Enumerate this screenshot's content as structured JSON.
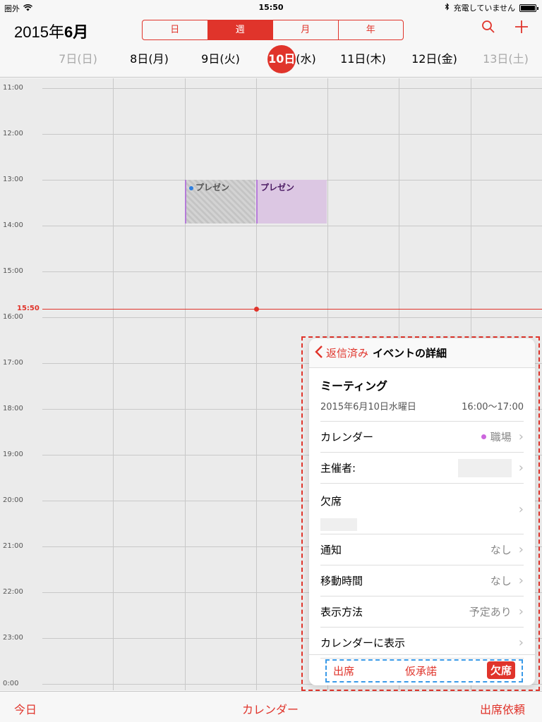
{
  "status": {
    "carrier": "圏外",
    "time": "15:50",
    "charge": "充電していません"
  },
  "header": {
    "year": "2015年",
    "month": "6月",
    "segments": [
      "日",
      "週",
      "月",
      "年"
    ],
    "active_segment": "週",
    "days": [
      "7日(日)",
      "8日(月)",
      "9日(火)",
      "10日",
      "11日(木)",
      "12日(金)",
      "13日(土)"
    ],
    "today_suffix": "(水)"
  },
  "grid": {
    "hours": [
      "11:00",
      "12:00",
      "13:00",
      "14:00",
      "15:00",
      "16:00",
      "17:00",
      "18:00",
      "19:00",
      "20:00",
      "21:00",
      "22:00",
      "23:00",
      "0:00"
    ],
    "now": "15:50",
    "events": [
      {
        "title": "プレゼン",
        "day": "9日(火)"
      },
      {
        "title": "プレゼン",
        "day": "10日"
      }
    ]
  },
  "popover": {
    "back": "返信済み",
    "title": "イベントの詳細",
    "event_title": "ミーティング",
    "date": "2015年6月10日水曜日",
    "time": "16:00〜17:00",
    "rows": {
      "calendar_label": "カレンダー",
      "calendar_value": "職場",
      "organizer_label": "主催者:",
      "declined_label": "欠席",
      "alert_label": "通知",
      "alert_value": "なし",
      "travel_label": "移動時間",
      "travel_value": "なし",
      "show_as_label": "表示方法",
      "show_as_value": "予定あり",
      "show_in_cal_label": "カレンダーに表示"
    },
    "responses": {
      "accept": "出席",
      "maybe": "仮承諾",
      "decline": "欠席"
    }
  },
  "toolbar": {
    "today": "今日",
    "calendars": "カレンダー",
    "invitations": "出席依頼"
  },
  "colors": {
    "accent": "#e0342b",
    "event": "#dcc7e3",
    "highlight_blue": "#3a9ae8"
  }
}
